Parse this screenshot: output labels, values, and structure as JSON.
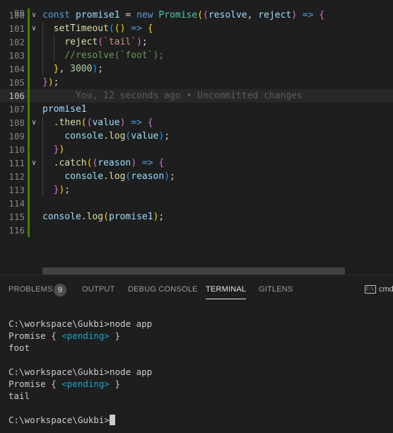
{
  "editor": {
    "top_partial_line_number": "99",
    "blame": "You, 12 seconds ago • Uncommitted changes",
    "lines": [
      {
        "n": "100",
        "fold": "∨",
        "tokens": [
          [
            "const ",
            "c-kw"
          ],
          [
            "promise1",
            "c-var"
          ],
          [
            " = ",
            "c-p"
          ],
          [
            "new ",
            "c-kw"
          ],
          [
            "Promise",
            "c-cls"
          ],
          [
            "(",
            "b1"
          ],
          [
            "(",
            "b2"
          ],
          [
            "resolve",
            "c-var"
          ],
          [
            ", ",
            "c-p"
          ],
          [
            "reject",
            "c-var"
          ],
          [
            ")",
            "b2"
          ],
          [
            " => ",
            "c-kw"
          ],
          [
            "{",
            "b2"
          ]
        ]
      },
      {
        "n": "101",
        "fold": "∨",
        "tokens": [
          [
            "  ",
            "c-p"
          ],
          [
            "setTimeout",
            "c-fn"
          ],
          [
            "(",
            "b3"
          ],
          [
            "(",
            "b1"
          ],
          [
            ")",
            "b1"
          ],
          [
            " => ",
            "c-kw"
          ],
          [
            "{",
            "b1"
          ]
        ]
      },
      {
        "n": "102",
        "fold": "",
        "tokens": [
          [
            "    ",
            "c-p"
          ],
          [
            "reject",
            "c-fn"
          ],
          [
            "(",
            "b2"
          ],
          [
            "`tail`",
            "c-str"
          ],
          [
            ")",
            "b2"
          ],
          [
            ";",
            "c-p"
          ]
        ]
      },
      {
        "n": "103",
        "fold": "",
        "tokens": [
          [
            "    ",
            "c-p"
          ],
          [
            "//resolve(`foot`);",
            "c-cm"
          ]
        ]
      },
      {
        "n": "104",
        "fold": "",
        "tokens": [
          [
            "  ",
            "c-p"
          ],
          [
            "}",
            "b1"
          ],
          [
            ", ",
            "c-p"
          ],
          [
            "3000",
            "c-num"
          ],
          [
            ")",
            "b3"
          ],
          [
            ";",
            "c-p"
          ]
        ]
      },
      {
        "n": "105",
        "fold": "",
        "tokens": [
          [
            "}",
            "b2"
          ],
          [
            ")",
            "b1"
          ],
          [
            ";",
            "c-p"
          ]
        ]
      },
      {
        "n": "106",
        "fold": "",
        "active": true,
        "blame": true,
        "tokens": []
      },
      {
        "n": "107",
        "fold": "",
        "tokens": [
          [
            "promise1",
            "c-var"
          ]
        ]
      },
      {
        "n": "108",
        "fold": "∨",
        "tokens": [
          [
            "  .",
            "c-p"
          ],
          [
            "then",
            "c-fn"
          ],
          [
            "(",
            "b1"
          ],
          [
            "(",
            "b2"
          ],
          [
            "value",
            "c-var"
          ],
          [
            ")",
            "b2"
          ],
          [
            " => ",
            "c-kw"
          ],
          [
            "{",
            "b2"
          ]
        ]
      },
      {
        "n": "109",
        "fold": "",
        "tokens": [
          [
            "    ",
            "c-p"
          ],
          [
            "console",
            "c-var"
          ],
          [
            ".",
            "c-p"
          ],
          [
            "log",
            "c-fn"
          ],
          [
            "(",
            "b3"
          ],
          [
            "value",
            "c-var"
          ],
          [
            ")",
            "b3"
          ],
          [
            ";",
            "c-p"
          ]
        ]
      },
      {
        "n": "110",
        "fold": "",
        "tokens": [
          [
            "  ",
            "c-p"
          ],
          [
            "}",
            "b2"
          ],
          [
            ")",
            "b1"
          ]
        ]
      },
      {
        "n": "111",
        "fold": "∨",
        "tokens": [
          [
            "  .",
            "c-p"
          ],
          [
            "catch",
            "c-fn"
          ],
          [
            "(",
            "b1"
          ],
          [
            "(",
            "b2"
          ],
          [
            "reason",
            "c-var"
          ],
          [
            ")",
            "b2"
          ],
          [
            " => ",
            "c-kw"
          ],
          [
            "{",
            "b2"
          ]
        ]
      },
      {
        "n": "112",
        "fold": "",
        "tokens": [
          [
            "    ",
            "c-p"
          ],
          [
            "console",
            "c-var"
          ],
          [
            ".",
            "c-p"
          ],
          [
            "log",
            "c-fn"
          ],
          [
            "(",
            "b3"
          ],
          [
            "reason",
            "c-var"
          ],
          [
            ")",
            "b3"
          ],
          [
            ";",
            "c-p"
          ]
        ]
      },
      {
        "n": "113",
        "fold": "",
        "tokens": [
          [
            "  ",
            "c-p"
          ],
          [
            "}",
            "b2"
          ],
          [
            ")",
            "b1"
          ],
          [
            ";",
            "c-p"
          ]
        ]
      },
      {
        "n": "114",
        "fold": "",
        "tokens": []
      },
      {
        "n": "115",
        "fold": "",
        "tokens": [
          [
            "console",
            "c-var"
          ],
          [
            ".",
            "c-p"
          ],
          [
            "log",
            "c-fn"
          ],
          [
            "(",
            "b1"
          ],
          [
            "promise1",
            "c-var"
          ],
          [
            ")",
            "b1"
          ],
          [
            ";",
            "c-p"
          ]
        ]
      },
      {
        "n": "116",
        "fold": "",
        "tokens": []
      }
    ]
  },
  "panel": {
    "tabs": {
      "problems": "PROBLEMS",
      "problems_count": "9",
      "output": "OUTPUT",
      "debug_console": "DEBUG CONSOLE",
      "terminal": "TERMINAL",
      "gitlens": "GITLENS"
    },
    "terminal_select_label": "cmd",
    "terminal_icon_glyph": "C:\\",
    "terminal_lines": [
      {
        "text": "C:\\workspace\\Gukbi>node app"
      },
      {
        "text": "Promise { ",
        "pending": "<pending>",
        "tail": " }"
      },
      {
        "text": "foot"
      },
      {
        "text": ""
      },
      {
        "text": "C:\\workspace\\Gukbi>node app"
      },
      {
        "text": "Promise { ",
        "pending": "<pending>",
        "tail": " }"
      },
      {
        "text": "tail"
      },
      {
        "text": ""
      },
      {
        "text": "C:\\workspace\\Gukbi>",
        "cursor": true
      }
    ]
  }
}
